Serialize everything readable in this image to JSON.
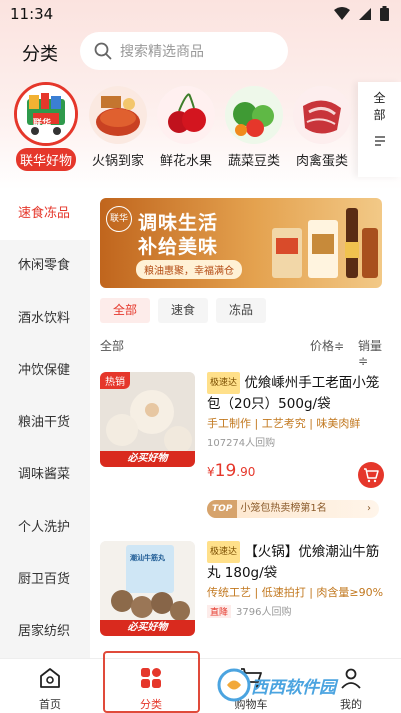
{
  "status": {
    "time": "11:34"
  },
  "header": {
    "title": "分类"
  },
  "search": {
    "placeholder": "搜索精选商品"
  },
  "categories": [
    {
      "label": "联华好物",
      "badge": "联华",
      "active": true
    },
    {
      "label": "火锅到家"
    },
    {
      "label": "鲜花水果"
    },
    {
      "label": "蔬菜豆类"
    },
    {
      "label": "肉禽蛋类"
    }
  ],
  "all_categories": {
    "label": "全部"
  },
  "sidebar": {
    "items": [
      {
        "label": "速食冻品",
        "active": true
      },
      {
        "label": "休闲零食"
      },
      {
        "label": "酒水饮料"
      },
      {
        "label": "冲饮保健"
      },
      {
        "label": "粮油干货"
      },
      {
        "label": "调味酱菜"
      },
      {
        "label": "个人洗护"
      },
      {
        "label": "厨卫百货"
      },
      {
        "label": "居家纺织"
      }
    ]
  },
  "banner": {
    "brand": "联华",
    "line1": "调味生活",
    "line2": "补给美味",
    "tagline": "粮油惠聚，幸福满仓"
  },
  "filters": [
    {
      "label": "全部",
      "active": true
    },
    {
      "label": "速食"
    },
    {
      "label": "冻品"
    }
  ],
  "sort": {
    "all": "全部",
    "price": "价格≑",
    "sales": "销量≑"
  },
  "products": [
    {
      "tag": "极速达",
      "name": "优飨嵊州手工老面小笼包（20只）500g/袋",
      "features": "手工制作 | 工艺考究 | 味美肉鲜",
      "sold": "107274人回购",
      "price_int": "19",
      "price_dec": ".90",
      "currency": "¥",
      "hot_tag": "热销",
      "must_buy": "必买好物",
      "rank_top": "TOP",
      "rank_text": "小笼包热卖榜第1名"
    },
    {
      "tag": "极速达",
      "name": "【火锅】优飨潮汕牛筋丸 180g/袋",
      "features": "传统工艺 | 低速拍打 | 肉含量≥90%",
      "down_tag": "直降",
      "sold": "3796人回购",
      "must_buy": "必买好物",
      "pack_label": "潮汕牛筋丸"
    }
  ],
  "tabbar": {
    "items": [
      {
        "label": "首页"
      },
      {
        "label": "分类",
        "active": true
      },
      {
        "label": "购物车"
      },
      {
        "label": "我的"
      }
    ]
  },
  "watermark": {
    "text": "西西软件园"
  },
  "colors": {
    "accent": "#e5372b",
    "feature": "#c2781f",
    "sidebar_bg": "#f5f5f5"
  }
}
